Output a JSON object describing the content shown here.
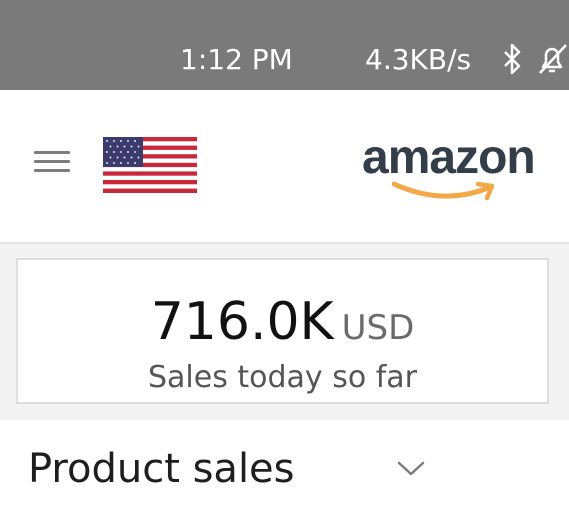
{
  "status_bar": {
    "time": "1:12 PM",
    "network_speed": "4.3KB/s",
    "icons": [
      "bluetooth-icon",
      "notifications-off-icon"
    ]
  },
  "header": {
    "menu_icon": "hamburger-menu-icon",
    "flag_icon": "us-flag-icon",
    "logo_text": "amazon"
  },
  "sales_card": {
    "value": "716.0K",
    "currency": "USD",
    "caption": "Sales today so far"
  },
  "product_sales": {
    "title": "Product sales",
    "toggle_icon": "chevron-down-icon"
  },
  "colors": {
    "status_bar_bg": "#7a7a7a",
    "logo_text": "#333e48",
    "logo_smile": "#f3a847",
    "page_bg": "#f3f3f3"
  }
}
